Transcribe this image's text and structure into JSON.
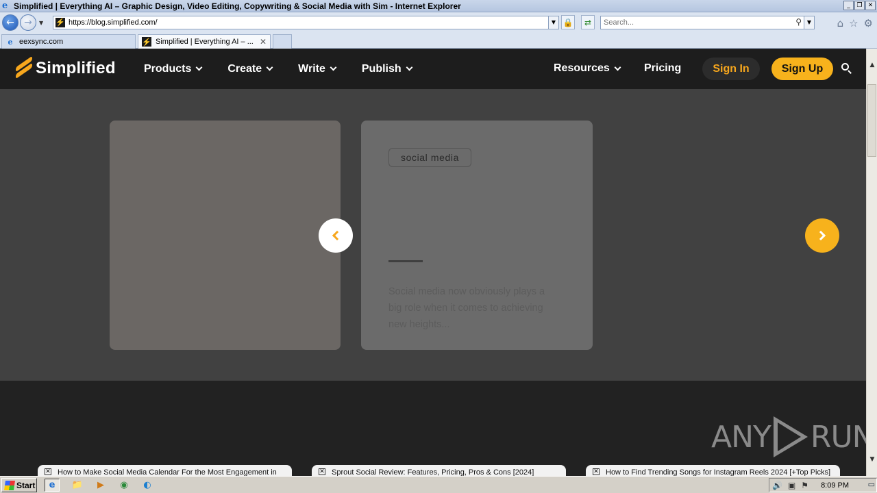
{
  "window": {
    "title": "Simplified | Everything AI – Graphic Design, Video Editing, Copywriting & Social Media with Sim - Internet Explorer",
    "app_icon": "ie-icon",
    "minimize": "_",
    "restore": "❐",
    "close": "✕"
  },
  "addressbar": {
    "url": "https://blog.simplified.com/",
    "search_placeholder": "Search...",
    "back_glyph": "←",
    "forward_glyph": "→",
    "lock_glyph": "🔒",
    "refresh_glyph": "⇄",
    "search_glyph": "⚲",
    "dropdown_glyph": "▼",
    "home_glyph": "⌂",
    "favorites_glyph": "☆",
    "tools_glyph": "⚙"
  },
  "tabs": [
    {
      "label": "eexsync.com",
      "icon": "ie-icon",
      "active": false
    },
    {
      "label": "Simplified | Everything AI – ...",
      "icon": "simplified-favicon",
      "active": true,
      "close": "✕"
    }
  ],
  "site_nav": {
    "brand": "Simplified",
    "items": [
      "Products",
      "Create",
      "Write",
      "Publish"
    ],
    "resources": "Resources",
    "pricing": "Pricing",
    "signin": "Sign In",
    "signup": "Sign Up",
    "accent_color": "#f7b21c"
  },
  "carousel": {
    "card2": {
      "tag": "social media",
      "excerpt": "Social media now obviously plays a big role when it comes to achieving new heights..."
    },
    "prev_icon": "chevron-left-icon",
    "next_icon": "chevron-right-icon"
  },
  "footer_popups": [
    {
      "check": "✕",
      "text": "How to Make Social Media Calendar For the Most Engagement in"
    },
    {
      "check": "✕",
      "text": "Sprout Social Review: Features, Pricing, Pros & Cons [2024]"
    },
    {
      "check": "✕",
      "text": "How to Find Trending Songs for Instagram Reels 2024 [+Top Picks]"
    }
  ],
  "watermark": {
    "left": "ANY",
    "right": "RUN"
  },
  "scrollbar": {
    "up": "▲",
    "down": "▼"
  },
  "taskbar": {
    "start": "Start",
    "time": "8:09 PM",
    "icons": [
      "ie-icon",
      "folder-icon",
      "media-player-icon",
      "chrome-icon",
      "edge-icon"
    ],
    "icon_glyphs": [
      "e",
      "📁",
      "▶",
      "◉",
      "◐"
    ],
    "tray_glyphs": [
      "🔊",
      "▣",
      "⚑"
    ],
    "show_desktop": "▭"
  }
}
